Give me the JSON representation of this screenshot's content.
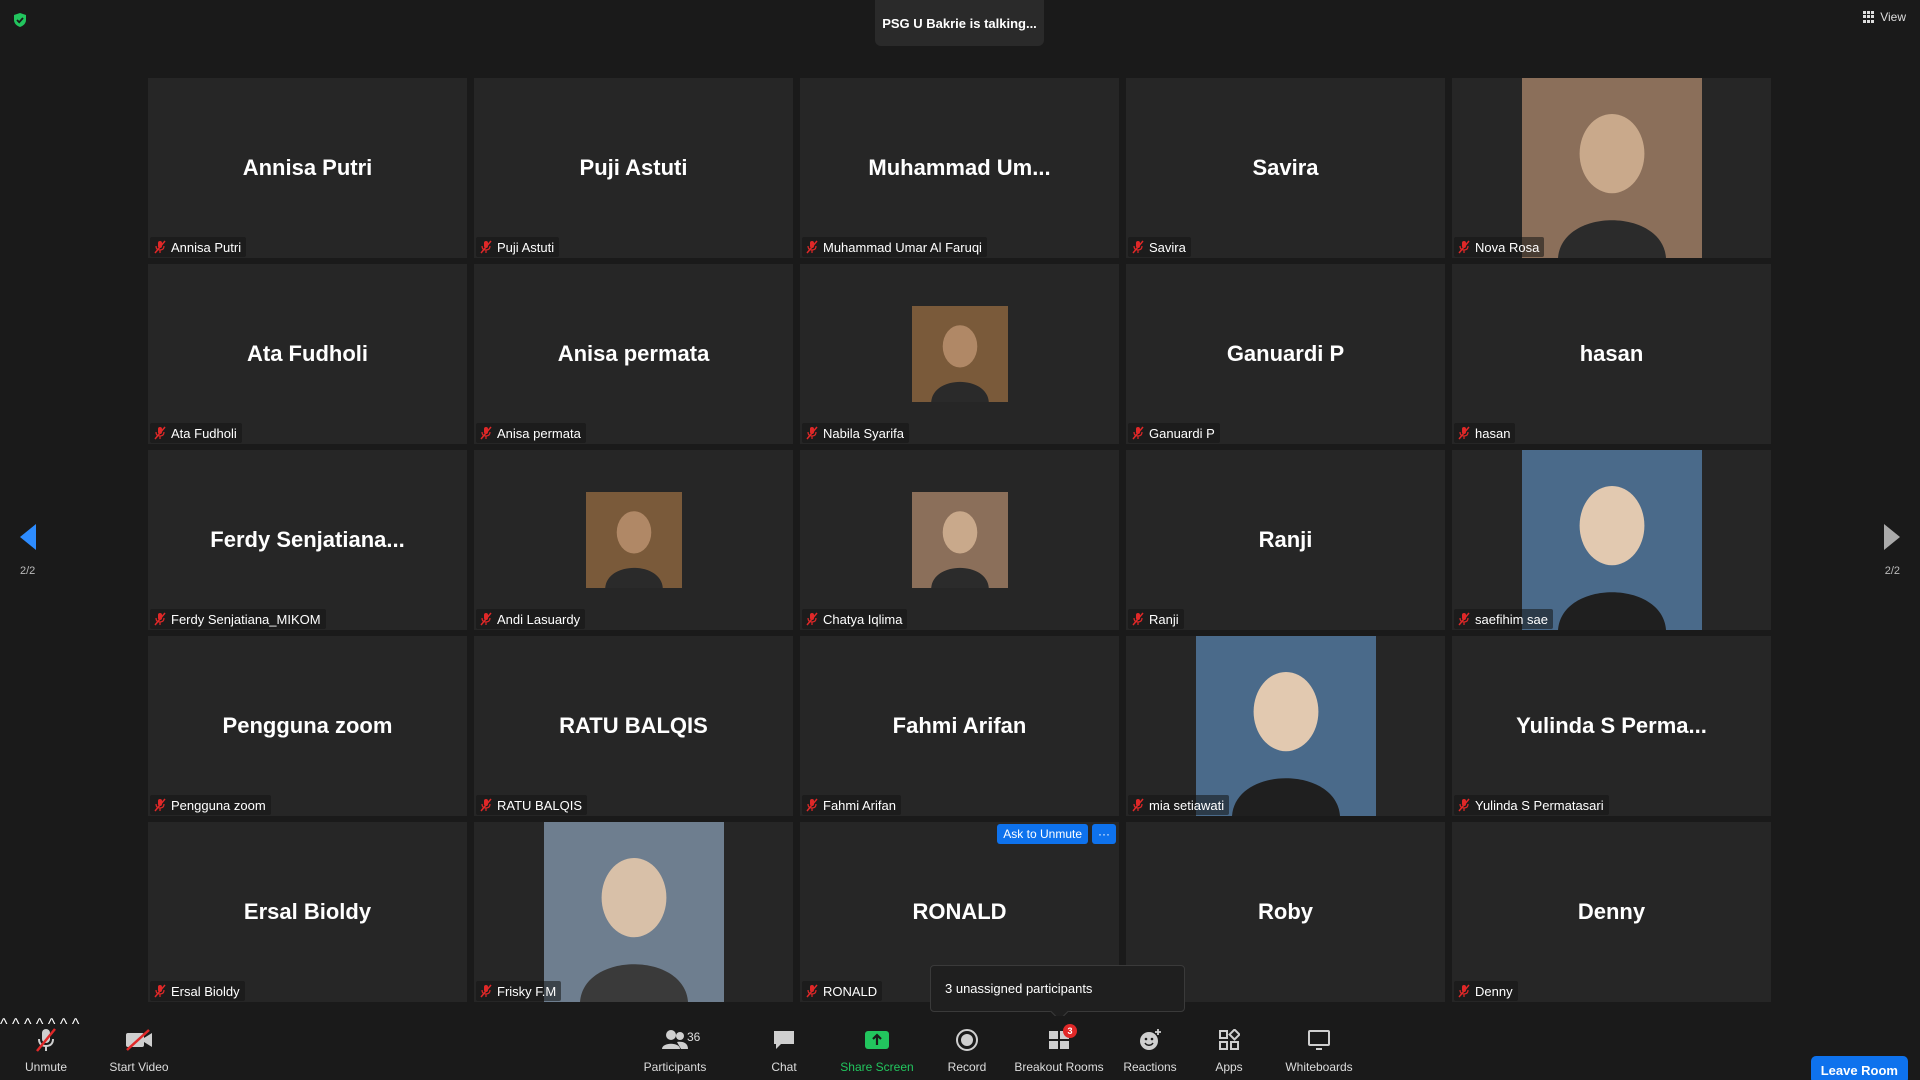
{
  "banner": {
    "talking": "PSG U Bakrie is talking..."
  },
  "view_label": "View",
  "pagination": {
    "left": "2/2",
    "right": "2/2"
  },
  "tiles": [
    {
      "display": "Annisa Putri",
      "name": "Annisa Putri",
      "photo": "none"
    },
    {
      "display": "Puji Astuti",
      "name": "Puji Astuti",
      "photo": "none"
    },
    {
      "display": "Muhammad  Um...",
      "name": "Muhammad Umar Al Faruqi",
      "photo": "none"
    },
    {
      "display": "Savira",
      "name": "Savira",
      "photo": "none"
    },
    {
      "display": "",
      "name": "Nova Rosa",
      "photo": "large"
    },
    {
      "display": "Ata Fudholi",
      "name": "Ata Fudholi",
      "photo": "none"
    },
    {
      "display": "Anisa permata",
      "name": "Anisa permata",
      "photo": "none"
    },
    {
      "display": "",
      "name": "Nabila Syarifa",
      "photo": "small"
    },
    {
      "display": "Ganuardi P",
      "name": "Ganuardi P",
      "photo": "none"
    },
    {
      "display": "hasan",
      "name": "hasan",
      "photo": "none"
    },
    {
      "display": "Ferdy  Senjatiana...",
      "name": "Ferdy Senjatiana_MIKOM",
      "photo": "none"
    },
    {
      "display": "",
      "name": "Andi Lasuardy",
      "photo": "small"
    },
    {
      "display": "",
      "name": "Chatya Iqlima",
      "photo": "small"
    },
    {
      "display": "Ranji",
      "name": "Ranji",
      "photo": "none"
    },
    {
      "display": "",
      "name": "saefihim sae",
      "photo": "large"
    },
    {
      "display": "Pengguna zoom",
      "name": "Pengguna zoom",
      "photo": "none"
    },
    {
      "display": "RATU BALQIS",
      "name": "RATU BALQIS",
      "photo": "none"
    },
    {
      "display": "Fahmi Arifan",
      "name": "Fahmi Arifan",
      "photo": "none"
    },
    {
      "display": "",
      "name": "mia setiawati",
      "photo": "large"
    },
    {
      "display": "Yulinda  S  Perma...",
      "name": "Yulinda S Permatasari",
      "photo": "none"
    },
    {
      "display": "Ersal Bioldy",
      "name": "Ersal Bioldy",
      "photo": "none"
    },
    {
      "display": "",
      "name": "Frisky F.M",
      "photo": "large"
    },
    {
      "display": "RONALD",
      "name": "RONALD",
      "photo": "none",
      "ask_unmute": true
    },
    {
      "display": "Roby",
      "name": "",
      "photo": "none"
    },
    {
      "display": "Denny",
      "name": "Denny",
      "photo": "none"
    }
  ],
  "ask_unmute": {
    "label": "Ask to Unmute",
    "more": "···"
  },
  "unassigned_tip": "3 unassigned participants",
  "toolbar": {
    "unmute": "Unmute",
    "start_video": "Start Video",
    "participants": "Participants",
    "participants_count": "36",
    "chat": "Chat",
    "share_screen": "Share Screen",
    "record": "Record",
    "breakout_rooms": "Breakout Rooms",
    "breakout_badge": "3",
    "reactions": "Reactions",
    "apps": "Apps",
    "whiteboards": "Whiteboards",
    "leave": "Leave Room",
    "caret": "^"
  },
  "colors": {
    "accent": "#0e72ed",
    "muted_red": "#e02828",
    "share_green": "#22c55e",
    "background": "#1a1a1a",
    "tile": "#262626"
  }
}
